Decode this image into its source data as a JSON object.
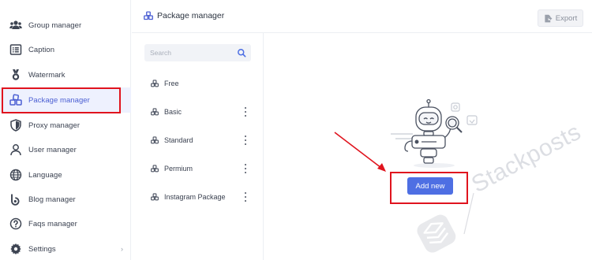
{
  "sidebar": {
    "items": [
      {
        "label": "Group manager",
        "icon": "users-icon"
      },
      {
        "label": "Caption",
        "icon": "list-alt-icon"
      },
      {
        "label": "Watermark",
        "icon": "medal-icon"
      },
      {
        "label": "Package manager",
        "icon": "cubes-icon",
        "active": true
      },
      {
        "label": "Proxy manager",
        "icon": "shield-icon"
      },
      {
        "label": "User manager",
        "icon": "user-icon"
      },
      {
        "label": "Language",
        "icon": "globe-icon"
      },
      {
        "label": "Blog manager",
        "icon": "blog-icon"
      },
      {
        "label": "Faqs manager",
        "icon": "question-circle-icon"
      },
      {
        "label": "Settings",
        "icon": "gear-icon",
        "chevron": "›"
      }
    ]
  },
  "header": {
    "title": "Package manager",
    "export_label": "Export"
  },
  "search": {
    "placeholder": "Search"
  },
  "packages": [
    {
      "label": "Free",
      "has_menu": false
    },
    {
      "label": "Basic",
      "has_menu": true
    },
    {
      "label": "Standard",
      "has_menu": true
    },
    {
      "label": "Permium",
      "has_menu": true
    },
    {
      "label": "Instagram Package",
      "has_menu": true
    }
  ],
  "empty_state": {
    "add_button_label": "Add new"
  },
  "watermark": {
    "text": "Stackposts"
  },
  "colors": {
    "accent": "#4e6fe3",
    "active_bg": "#eef1fe",
    "active_text": "#4b5fd3",
    "annotation_red": "#e0141e"
  }
}
